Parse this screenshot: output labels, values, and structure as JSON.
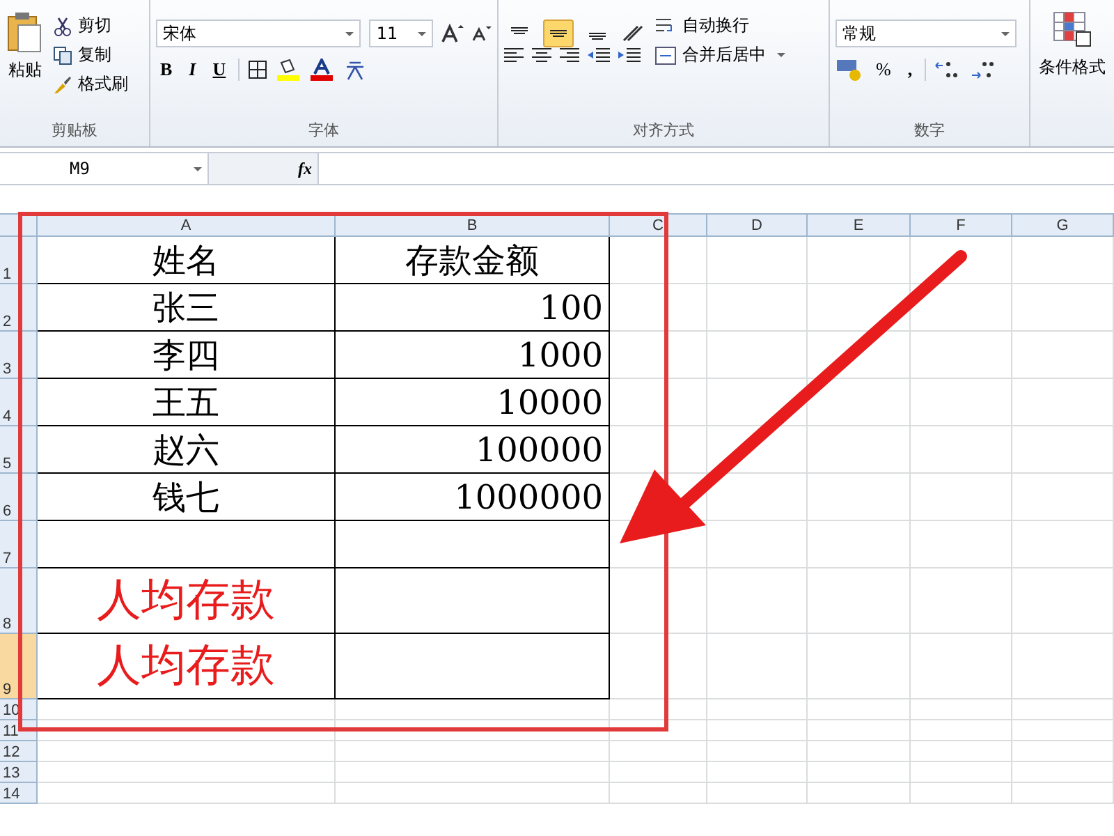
{
  "ribbon": {
    "clipboard": {
      "paste": "粘贴",
      "cut": "剪切",
      "copy": "复制",
      "painter": "格式刷",
      "label": "剪贴板"
    },
    "font": {
      "name": "宋体",
      "size": "11",
      "bold": "B",
      "italic": "I",
      "underline": "U",
      "label": "字体"
    },
    "alignment": {
      "align_buttons": [
        {
          "selected": false
        },
        {
          "selected": true
        },
        {
          "selected": false
        }
      ],
      "wrap": "自动换行",
      "merge": "合并后居中",
      "label": "对齐方式"
    },
    "number": {
      "format": "常规",
      "percent": "%",
      "comma": ",",
      "label": "数字"
    },
    "styles": {
      "conditional": "条件格式"
    }
  },
  "formula_bar": {
    "name_box": "M9",
    "fx": "fx"
  },
  "sheet": {
    "columns": [
      "A",
      "B",
      "C",
      "D",
      "E",
      "F",
      "G"
    ],
    "rows": [
      {
        "header": "1",
        "selected": false,
        "cells": [
          {
            "kind": "heading",
            "text": "姓名"
          },
          {
            "kind": "heading",
            "text": "存款金额"
          }
        ]
      },
      {
        "header": "2",
        "selected": false,
        "cells": [
          {
            "kind": "name",
            "text": "张三"
          },
          {
            "kind": "amount",
            "text": "100"
          }
        ]
      },
      {
        "header": "3",
        "selected": false,
        "cells": [
          {
            "kind": "name",
            "text": "李四"
          },
          {
            "kind": "amount",
            "text": "1000"
          }
        ]
      },
      {
        "header": "4",
        "selected": false,
        "cells": [
          {
            "kind": "name",
            "text": "王五"
          },
          {
            "kind": "amount",
            "text": "10000"
          }
        ]
      },
      {
        "header": "5",
        "selected": false,
        "cells": [
          {
            "kind": "name",
            "text": "赵六"
          },
          {
            "kind": "amount",
            "text": "100000"
          }
        ]
      },
      {
        "header": "6",
        "selected": false,
        "cells": [
          {
            "kind": "name",
            "text": "钱七"
          },
          {
            "kind": "amount",
            "text": "1000000"
          }
        ]
      },
      {
        "header": "7",
        "selected": false,
        "cells": [
          {
            "kind": "empty",
            "text": ""
          },
          {
            "kind": "empty",
            "text": ""
          }
        ]
      },
      {
        "header": "8",
        "selected": false,
        "cells": [
          {
            "kind": "label",
            "text": "人均存款"
          },
          {
            "kind": "empty",
            "text": ""
          }
        ]
      },
      {
        "header": "9",
        "selected": true,
        "cells": [
          {
            "kind": "label",
            "text": "人均存款"
          },
          {
            "kind": "empty",
            "text": ""
          }
        ]
      },
      {
        "header": "10",
        "selected": false,
        "cells": []
      },
      {
        "header": "11",
        "selected": false,
        "cells": []
      },
      {
        "header": "12",
        "selected": false,
        "cells": []
      },
      {
        "header": "13",
        "selected": false,
        "cells": []
      },
      {
        "header": "14",
        "selected": false,
        "cells": []
      }
    ]
  }
}
